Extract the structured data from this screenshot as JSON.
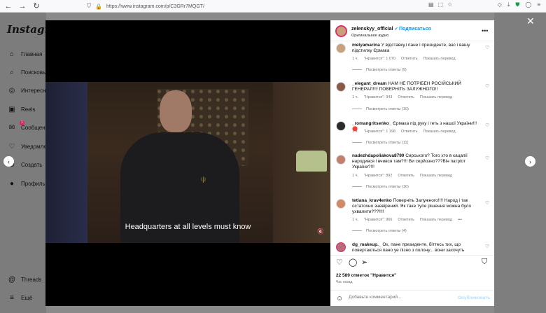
{
  "browser": {
    "url": "https://www.instagram.com/p/C3GRr7MQGT/"
  },
  "sidebar": {
    "logo": "Instagram",
    "items": [
      {
        "label": "Главная",
        "icon": "home-icon",
        "glyph": "⌂"
      },
      {
        "label": "Поисковый",
        "icon": "search-icon",
        "glyph": "⌕"
      },
      {
        "label": "Интересное",
        "icon": "compass-icon",
        "glyph": "◎"
      },
      {
        "label": "Reels",
        "icon": "reels-icon",
        "glyph": "▣"
      },
      {
        "label": "Сообщения",
        "icon": "messenger-icon",
        "glyph": "✉",
        "badge": "1"
      },
      {
        "label": "Уведомления",
        "icon": "heart-icon",
        "glyph": "♡"
      },
      {
        "label": "Создать",
        "icon": "plus-icon",
        "glyph": "⊕"
      },
      {
        "label": "Профиль",
        "icon": "profile-icon",
        "glyph": "●"
      }
    ],
    "bottom": [
      {
        "label": "Threads",
        "icon": "threads-icon",
        "glyph": "@"
      },
      {
        "label": "Ещё",
        "icon": "menu-icon",
        "glyph": "≡"
      }
    ]
  },
  "video": {
    "subtitle": "Headquarters at all levels must know"
  },
  "post": {
    "username": "zelenskyy_official",
    "follow_label": "Подписаться",
    "audio": "Оригинальное аудио"
  },
  "comments": [
    {
      "user": "melyamarina",
      "text": "У відставку,і пане і президенте, вас і вашу підстилку Єрмака",
      "time": "1 ч.",
      "likes": "\"Нравится\": 1 070",
      "reply": "Ответить",
      "translate": "Показать перевод",
      "replies": "Посмотреть ответы (9)"
    },
    {
      "user": "_elegant_dream",
      "text": "НАМ НЕ ПОТРІБЕН РОСІЙСЬКИЙ ГЕНЕРАЛ!!!! ПОВЕРНІТЬ ЗАЛУЖНОГО!!",
      "time": "1 ч.",
      "likes": "\"Нравится\": 943",
      "reply": "Ответить",
      "translate": "Показать перевод",
      "replies": "Посмотреть ответы (10)"
    },
    {
      "user": "_romangritsenko_",
      "text": "Єрмака під руку і геть з нашої України!!! 🔴",
      "time": "1 ч.",
      "likes": "\"Нравится\": 1 198",
      "reply": "Ответить",
      "translate": "Показать перевод",
      "replies": "Посмотреть ответы (11)"
    },
    {
      "user": "nadezhdapoliakova8790",
      "text": "Сирського? Того хто в кацапії народився і вчився там?!!! Ви серйозно???Він патріот України?!!!",
      "time": "1 ч.",
      "likes": "\"Нравится\": 892",
      "reply": "Ответить",
      "translate": "Показать перевод",
      "replies": "Посмотреть ответы (16)"
    },
    {
      "user": "tetiana_krav4enko",
      "text": "Поверніть Залужного!!!! Народ і так остаточно зневірений. Як таке тупе рішення можна було ухвалити???!!!!",
      "time": "1 ч.",
      "likes": "\"Нравится\": 966",
      "reply": "Ответить",
      "translate": "Показать перевод",
      "extra": "•••",
      "replies": "Посмотреть ответы (4)"
    },
    {
      "user": "dg_makeup._",
      "text": "Ох, пане президенте, біттесь тих, що повертаються пано уе пізно з полону... вони захочуть"
    }
  ],
  "actions": {
    "likes": "22 589 отметок \"Нравится\"",
    "time_ago": "Час назад",
    "comment_placeholder": "Добавьте комментарий...",
    "publish_label": "Опубликовать"
  }
}
